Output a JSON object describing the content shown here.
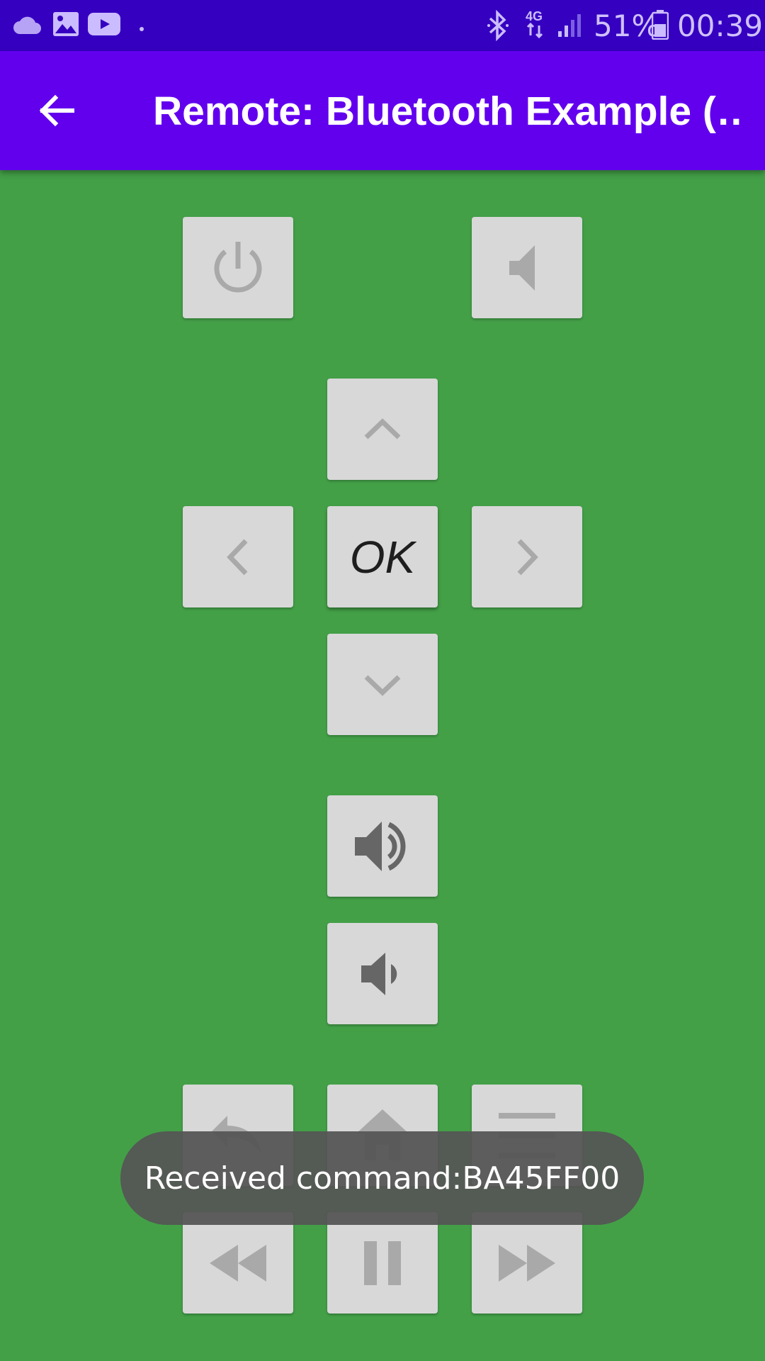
{
  "status_bar": {
    "battery": "51%",
    "time": "00:39",
    "network": "4G",
    "icons": [
      "cloud-icon",
      "gallery-icon",
      "youtube-icon",
      "dot-icon",
      "bluetooth-icon",
      "4g-icon",
      "signal-icon",
      "battery-icon"
    ]
  },
  "app_bar": {
    "title": "Remote: Bluetooth Example (…",
    "back_icon": "arrow-back-icon"
  },
  "remote": {
    "ok_label": "OK",
    "keys": [
      "power",
      "mute",
      "up",
      "left",
      "ok",
      "right",
      "down",
      "volume-up",
      "volume-down",
      "back",
      "home",
      "menu",
      "rewind",
      "pause",
      "fast-forward"
    ]
  },
  "toast": {
    "message": "Received command:BA45FF00"
  },
  "colors": {
    "status_bar": "#3500c0",
    "app_bar": "#6200ee",
    "background": "#43a047",
    "key": "#d8d8d8",
    "icon_light": "#a9a9a9",
    "icon_dark": "#666666",
    "toast": "#555555"
  }
}
